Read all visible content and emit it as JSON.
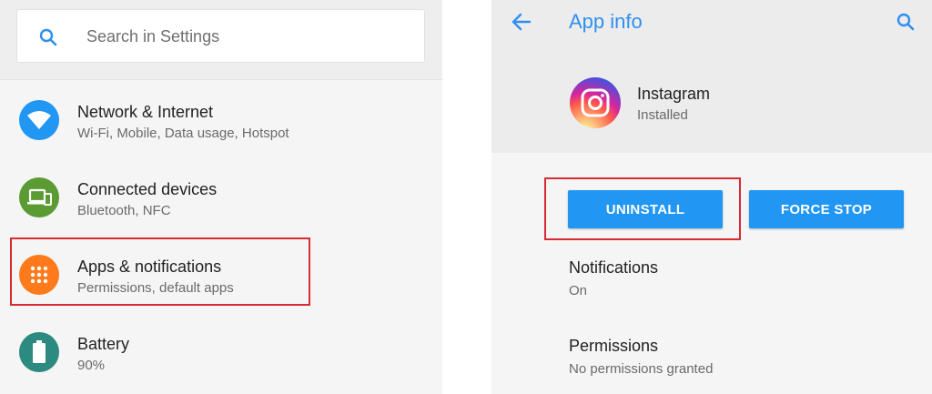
{
  "left_panel": {
    "search": {
      "placeholder": "Search in Settings"
    },
    "items": [
      {
        "title": "Network & Internet",
        "subtitle": "Wi-Fi, Mobile, Data usage, Hotspot",
        "icon": "wifi-icon",
        "color": "#2196f3"
      },
      {
        "title": "Connected devices",
        "subtitle": "Bluetooth, NFC",
        "icon": "devices-icon",
        "color": "#5b9b33"
      },
      {
        "title": "Apps & notifications",
        "subtitle": "Permissions, default apps",
        "icon": "apps-grid-icon",
        "color": "#ff7a1a"
      },
      {
        "title": "Battery",
        "subtitle": "90%",
        "icon": "battery-icon",
        "color": "#2c8a80"
      }
    ]
  },
  "right_panel": {
    "title": "App info",
    "app": {
      "name": "Instagram",
      "status": "Installed",
      "icon": "instagram-icon"
    },
    "buttons": {
      "uninstall": "UNINSTALL",
      "force_stop": "FORCE STOP"
    },
    "rows": [
      {
        "title": "Notifications",
        "value": "On"
      },
      {
        "title": "Permissions",
        "value": "No permissions granted"
      }
    ]
  },
  "colors": {
    "accent": "#2196f3",
    "title_blue": "#2f8ff0",
    "highlight_red": "#d92b32"
  }
}
